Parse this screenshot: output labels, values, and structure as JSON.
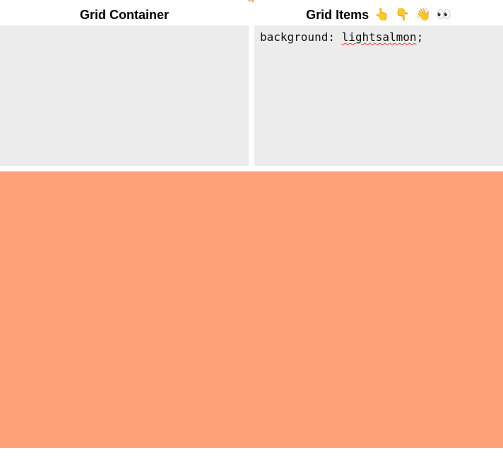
{
  "header": {
    "left_title": "Grid Container",
    "right_title": "Grid Items",
    "emojis": [
      "👆",
      "👇",
      "👋",
      "👀"
    ]
  },
  "editors": {
    "right_css": {
      "property": "background",
      "separator": ": ",
      "value": "lightsalmon",
      "terminator": ";"
    }
  },
  "preview": {
    "background": "#ffa07a"
  },
  "decorative": {
    "top_glyph": "g"
  }
}
